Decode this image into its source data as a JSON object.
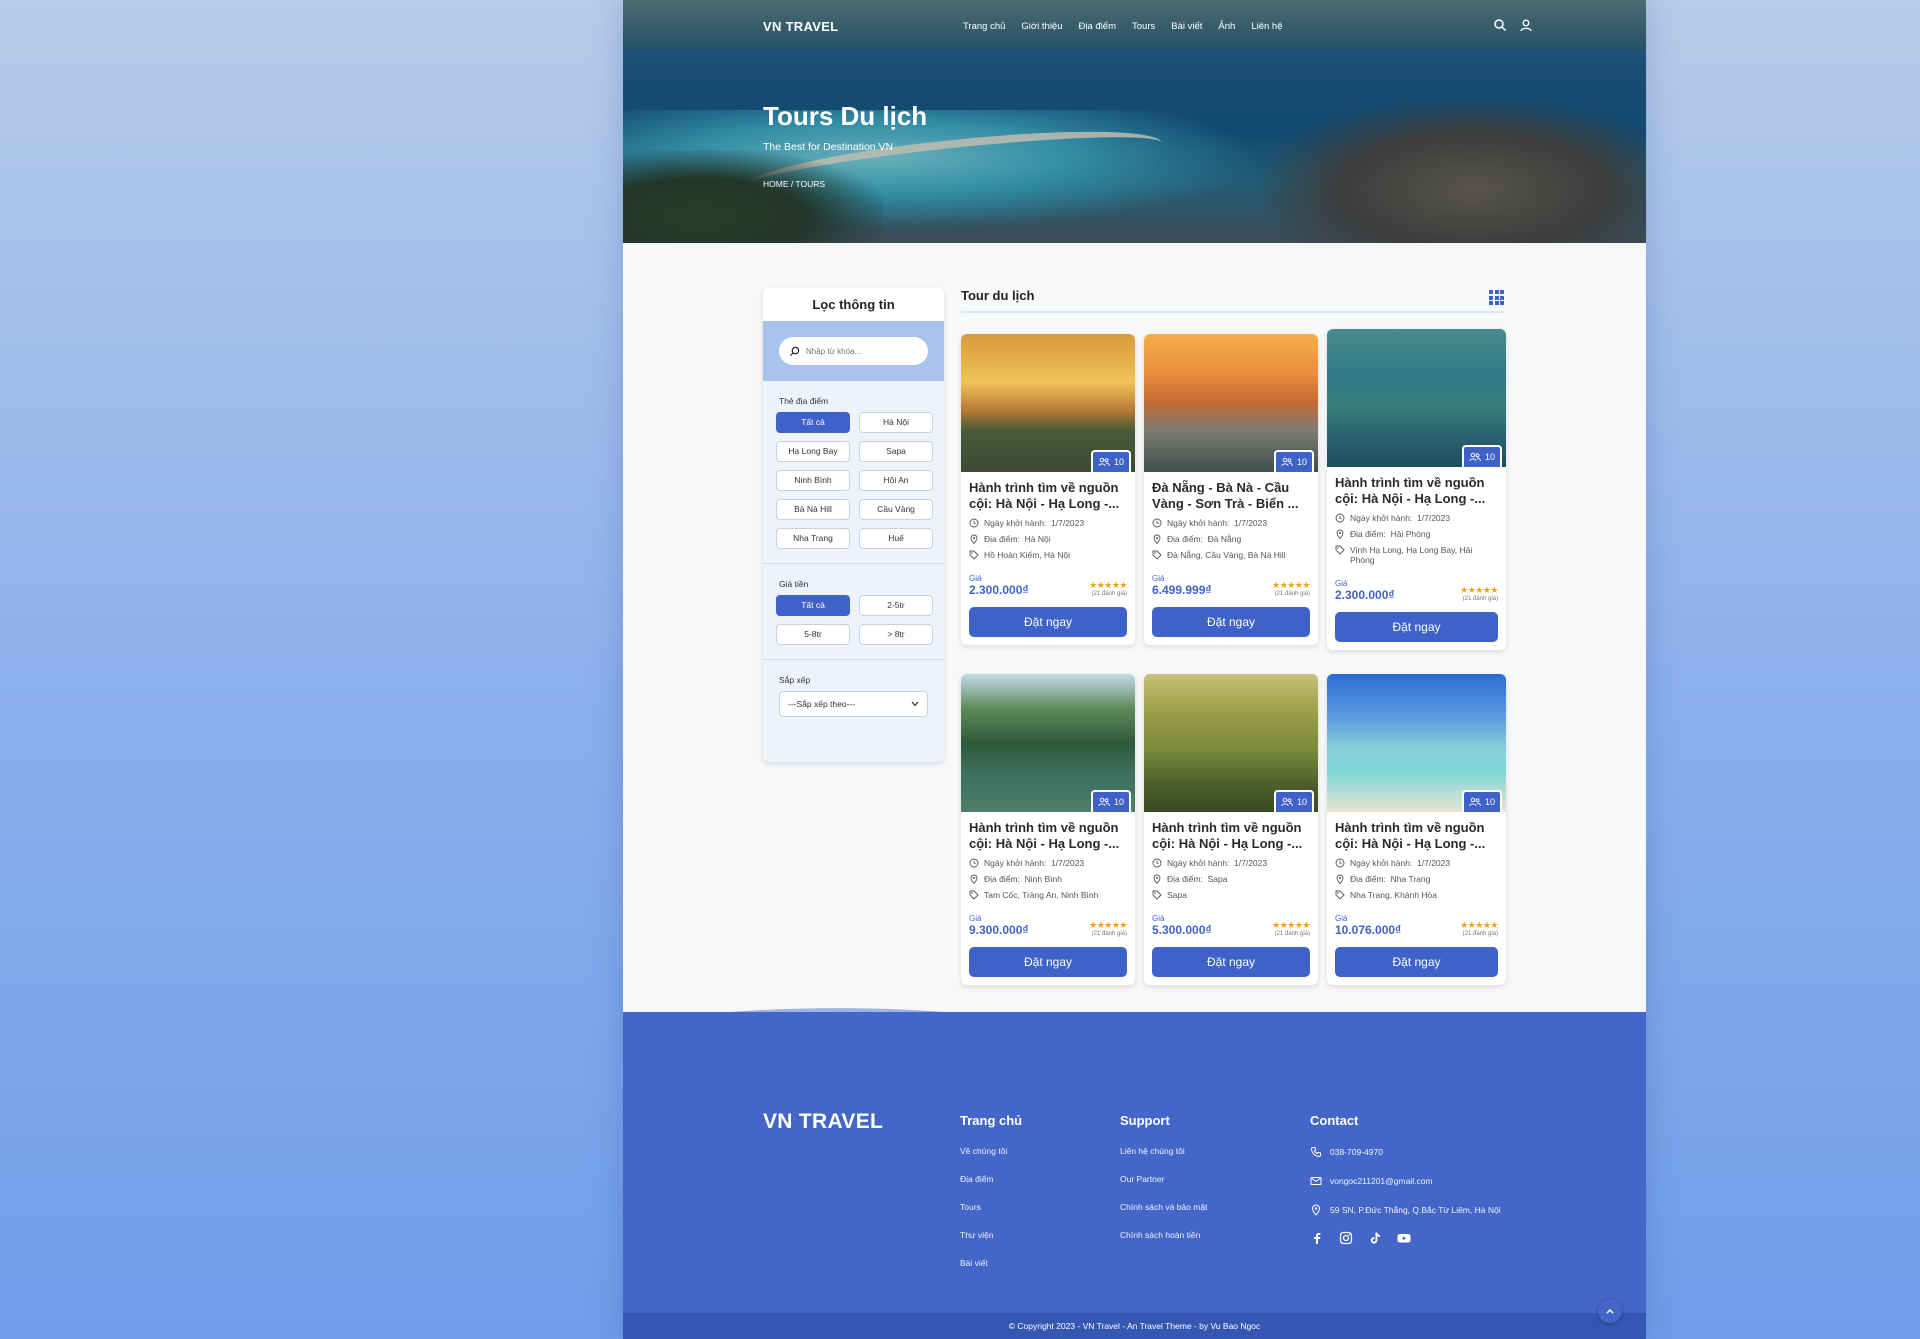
{
  "nav": {
    "logo": "VN TRAVEL",
    "links": [
      "Trang chủ",
      "Giới thiệu",
      "Địa điểm",
      "Tours",
      "Bài viết",
      "Ảnh",
      "Liên hệ"
    ]
  },
  "hero": {
    "title": "Tours Du lịch",
    "subtitle": "The Best for Destination VN",
    "breadcrumb": "HOME /  TOURS"
  },
  "filter": {
    "title": "Lọc thông tin",
    "search_placeholder": "Nhập từ khóa...",
    "location_label": "Thẻ địa điểm",
    "locations": [
      "Tất cả",
      "Hà Nội",
      "Hạ Long Bay",
      "Sapa",
      "Ninh Bình",
      "Hội An",
      "Bà Nà Hill",
      "Cầu Vàng",
      "Nha Trang",
      "Huế"
    ],
    "price_label": "Giá tiền",
    "prices": [
      "Tất cả",
      "2-5tr",
      "5-8tr",
      "> 8tr"
    ],
    "sort_label": "Sắp xếp",
    "sort_value": "---Sắp xếp theo---"
  },
  "tours": {
    "section_title": "Tour du lịch",
    "date_label": "Ngày khởi hành:",
    "place_label": "Địa điểm:",
    "price_label": "Giá",
    "reviews": "(21 đánh giá)",
    "book_label": "Đặt ngay",
    "items": [
      {
        "title": "Hành trình tìm về nguồn cội: Hà Nội - Hạ Long -...",
        "count": "10",
        "date": "1/7/2023",
        "place": "Hà Nội",
        "tags": "Hồ Hoàn Kiếm, Hà Nội",
        "price": "2.300.000₫"
      },
      {
        "title": "Đà Nẵng - Bà Nà - Cầu Vàng - Sơn Trà - Biển ...",
        "count": "10",
        "date": "1/7/2023",
        "place": "Đà Nẵng",
        "tags": "Đà Nẵng, Cầu Vàng, Bà Nà Hill",
        "price": "6.499.999₫"
      },
      {
        "title": "Hành trình tìm về nguồn cội: Hà Nội - Hạ Long -...",
        "count": "10",
        "date": "1/7/2023",
        "place": "Hải Phòng",
        "tags": "Vịnh Hạ Long, Hạ Long Bay, Hải Phòng",
        "price": "2.300.000₫"
      },
      {
        "title": "Hành trình tìm về nguồn cội: Hà Nội - Hạ Long -...",
        "count": "10",
        "date": "1/7/2023",
        "place": "Ninh Bình",
        "tags": "Tam Cốc, Tràng An, Ninh Bình",
        "price": "9.300.000₫"
      },
      {
        "title": "Hành trình tìm về nguồn cội: Hà Nội - Hạ Long -...",
        "count": "10",
        "date": "1/7/2023",
        "place": "Sapa",
        "tags": "Sapa",
        "price": "5.300.000₫"
      },
      {
        "title": "Hành trình tìm về nguồn cội: Hà Nội - Hạ Long -...",
        "count": "10",
        "date": "1/7/2023",
        "place": "Nha Trang",
        "tags": "Nha Trang, Khánh Hòa",
        "price": "10.076.000₫"
      }
    ]
  },
  "footer": {
    "logo": "VN TRAVEL",
    "col1_title": "Trang chủ",
    "col1_links": [
      "Về chúng tôi",
      "Địa điểm",
      "Tours",
      "Thư viện",
      "Bài viết"
    ],
    "col2_title": "Support",
    "col2_links": [
      "Liên hệ chúng tôi",
      "Our Partner",
      "Chính sách và bảo mật",
      "Chính sách hoàn tiền"
    ],
    "col3_title": "Contact",
    "phone": "038-709-4970",
    "email": "vongoc211201@gmail.com",
    "address": "59 SN, P.Đức Thắng, Q.Bắc Từ Liêm, Hà Nội",
    "copyright": "© Copyright 2023 - VN Travel - An Travel Theme - by Vu Bao Ngoc"
  },
  "colors": {
    "primary": "#3f62c8",
    "footer": "#4466c9",
    "star": "#f1a10c"
  }
}
